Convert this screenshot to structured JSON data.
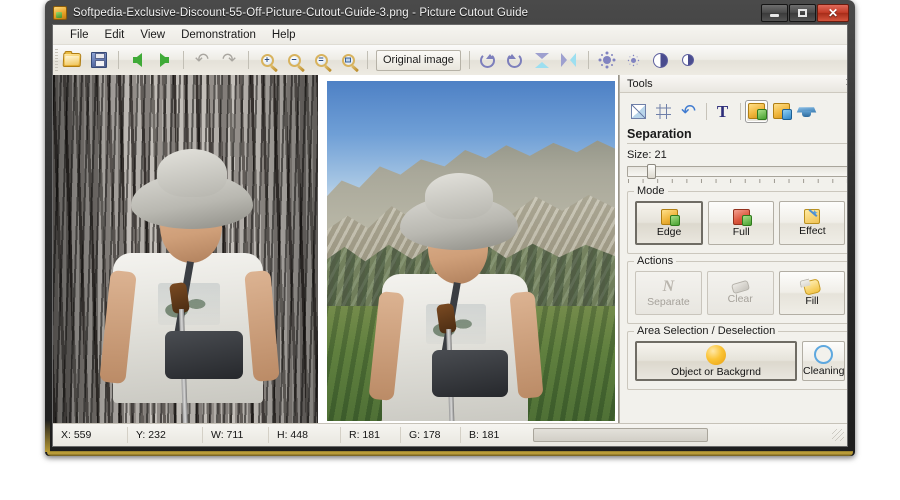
{
  "window": {
    "title": "Softpedia-Exclusive-Discount-55-Off-Picture-Cutout-Guide-3.png - Picture Cutout Guide",
    "app_icon": "picture-cutout-guide-icon",
    "controls": {
      "minimize": "–",
      "maximize": "□",
      "close": "✕"
    }
  },
  "menu": {
    "items": [
      {
        "label": "File"
      },
      {
        "label": "Edit"
      },
      {
        "label": "View"
      },
      {
        "label": "Demonstration"
      },
      {
        "label": "Help"
      }
    ]
  },
  "toolbar": {
    "original_image_label": "Original image",
    "buttons": [
      {
        "name": "open-icon",
        "title": "Open"
      },
      {
        "name": "save-icon",
        "title": "Save"
      },
      {
        "name": "back-arrow-icon",
        "title": "Back"
      },
      {
        "name": "forward-arrow-icon",
        "title": "Forward"
      },
      {
        "name": "undo-icon",
        "title": "Undo"
      },
      {
        "name": "redo-icon",
        "title": "Redo"
      },
      {
        "name": "zoom-in-icon",
        "title": "Zoom In"
      },
      {
        "name": "zoom-out-icon",
        "title": "Zoom Out"
      },
      {
        "name": "zoom-fit-icon",
        "title": "Fit"
      },
      {
        "name": "zoom-actual-icon",
        "title": "Actual Size"
      },
      {
        "name": "rotate-cw-icon",
        "title": "Rotate Clockwise"
      },
      {
        "name": "rotate-ccw-icon",
        "title": "Rotate Counter-clockwise"
      },
      {
        "name": "flip-vertical-icon",
        "title": "Flip Vertical"
      },
      {
        "name": "flip-horizontal-icon",
        "title": "Flip Horizontal"
      },
      {
        "name": "brightness-icon",
        "title": "Brightness"
      },
      {
        "name": "settings-icon",
        "title": "Settings"
      },
      {
        "name": "contrast-icon",
        "title": "Contrast"
      },
      {
        "name": "gamma-icon",
        "title": "Gamma"
      }
    ]
  },
  "tools_panel": {
    "header": "Tools",
    "close_glyph": "✕",
    "tool_icons": [
      {
        "name": "crop-icon"
      },
      {
        "name": "grid-icon"
      },
      {
        "name": "undo-icon"
      },
      {
        "name": "text-tool-icon"
      },
      {
        "name": "separation-tool-icon"
      },
      {
        "name": "restore-tool-icon"
      },
      {
        "name": "effects-tool-icon"
      }
    ],
    "section_title": "Separation",
    "size_label": "Size: 21",
    "size_value": 21,
    "mode": {
      "group_label": "Mode",
      "buttons": [
        {
          "label": "Edge",
          "selected": true,
          "enabled": true
        },
        {
          "label": "Full",
          "selected": false,
          "enabled": true
        },
        {
          "label": "Effect",
          "selected": false,
          "enabled": true
        }
      ]
    },
    "actions": {
      "group_label": "Actions",
      "buttons": [
        {
          "label": "Separate",
          "enabled": false
        },
        {
          "label": "Clear",
          "enabled": false
        },
        {
          "label": "Fill",
          "enabled": true
        }
      ]
    },
    "area_selection": {
      "group_label": "Area Selection / Deselection",
      "buttons": [
        {
          "label": "Object or Backgrnd",
          "selected": true
        },
        {
          "label": "Cleaning",
          "selected": false
        }
      ]
    }
  },
  "status_bar": {
    "cells": [
      {
        "label": "X: 559"
      },
      {
        "label": "Y: 232"
      },
      {
        "label": "W: 711"
      },
      {
        "label": "H: 448"
      },
      {
        "label": "R: 181"
      },
      {
        "label": "G: 178"
      },
      {
        "label": "B: 181"
      }
    ],
    "progress_percent": 0
  },
  "colors": {
    "accent_orange": "#fbc436",
    "accent_blue": "#5ea8df",
    "close_red": "#c23a26",
    "panel_bg": "#f2f1ec"
  }
}
